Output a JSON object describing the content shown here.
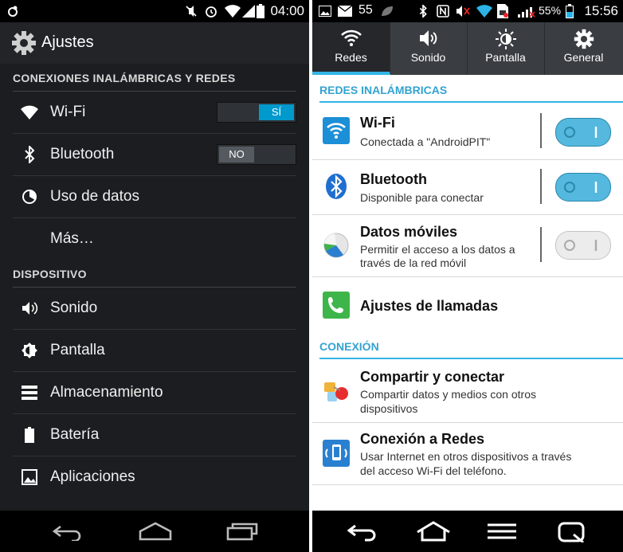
{
  "left": {
    "status": {
      "time": "04:00"
    },
    "header": {
      "title": "Ajustes"
    },
    "sections": [
      {
        "title": "CONEXIONES INALÁMBRICAS Y REDES"
      },
      {
        "title": "DISPOSITIVO"
      }
    ],
    "items": [
      {
        "label": "Wi-Fi",
        "toggle": "SÍ"
      },
      {
        "label": "Bluetooth",
        "toggle": "NO"
      },
      {
        "label": "Uso de datos"
      },
      {
        "label": "Más…"
      },
      {
        "label": "Sonido"
      },
      {
        "label": "Pantalla"
      },
      {
        "label": "Almacenamiento"
      },
      {
        "label": "Batería"
      },
      {
        "label": "Aplicaciones"
      }
    ]
  },
  "right": {
    "status": {
      "notification_count": "55",
      "battery": "55%",
      "time": "15:56"
    },
    "tabs": [
      {
        "label": "Redes",
        "active": true
      },
      {
        "label": "Sonido"
      },
      {
        "label": "Pantalla"
      },
      {
        "label": "General"
      }
    ],
    "sections": [
      {
        "title": "REDES INALÁMBRICAS"
      },
      {
        "title": "CONEXIÓN"
      }
    ],
    "items": [
      {
        "title": "Wi-Fi",
        "subtitle": "Conectada a \"AndroidPIT\"",
        "toggle_on": true
      },
      {
        "title": "Bluetooth",
        "subtitle": "Disponible para conectar",
        "toggle_on": true
      },
      {
        "title": "Datos móviles",
        "subtitle_1": "Permitir el acceso a los datos a",
        "subtitle_2": "través de la red móvil",
        "toggle_on": false
      },
      {
        "title": "Ajustes de llamadas"
      },
      {
        "title": "Compartir y conectar",
        "subtitle_1": "Compartir datos y medios con otros",
        "subtitle_2": "dispositivos"
      },
      {
        "title": "Conexión a Redes",
        "subtitle_1": "Usar Internet en otros dispositivos a través",
        "subtitle_2": "del acceso Wi-Fi del teléfono."
      }
    ]
  },
  "colors": {
    "accent": "#33b5e5",
    "toggle_on": "#55b8de"
  }
}
